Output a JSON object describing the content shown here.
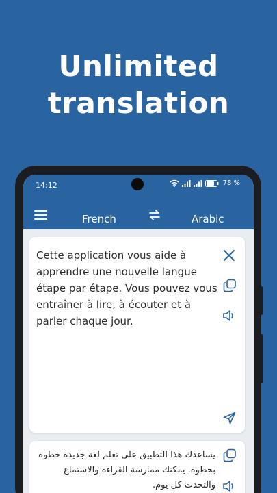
{
  "promo": {
    "headline_line1": "Unlimited",
    "headline_line2": "translation"
  },
  "statusbar": {
    "time": "14:12",
    "battery": "78 %",
    "icons": [
      "wifi-icon",
      "signal-icon",
      "signal-icon",
      "battery-icon"
    ]
  },
  "appbar": {
    "menu_icon": "hamburger-menu-icon",
    "source_language": "French",
    "swap_icon": "swap-arrows-icon",
    "target_language": "Arabic"
  },
  "input_card": {
    "text": "Cette application vous aide à apprendre une nouvelle langue étape par étape. Vous pouvez vous entraîner à lire, à écouter et à parler chaque jour.",
    "icons": [
      "close-icon",
      "copy-icon",
      "speaker-icon",
      "send-icon"
    ]
  },
  "result_card": {
    "text": "يساعدك هذا التطبيق على تعلم لغة جديدة خطوة بخطوة. يمكنك ممارسة القراءة والاستماع والتحدث كل يوم.",
    "icons": [
      "copy-icon",
      "speaker-icon"
    ]
  },
  "colors": {
    "brand_blue": "#2a64a0",
    "screen_bg": "#e9edf1",
    "icon_blue": "#2a64a0"
  }
}
